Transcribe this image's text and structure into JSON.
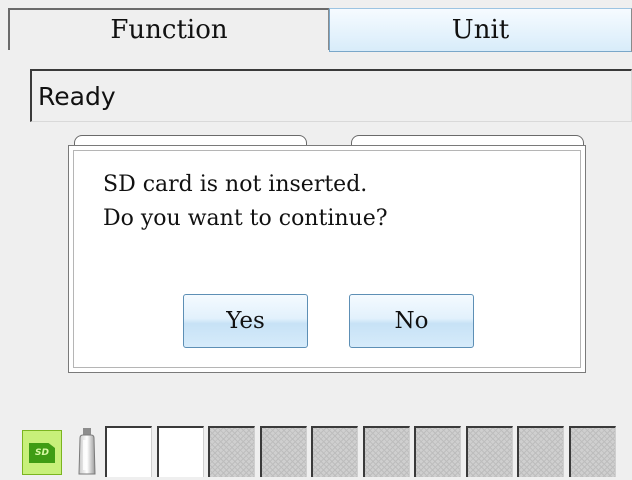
{
  "tabs": {
    "function_label": "Function",
    "unit_label": "Unit"
  },
  "status": {
    "text": "Ready"
  },
  "dialog": {
    "line1": "SD card is not inserted.",
    "line2": "Do you want to continue?",
    "yes_label": "Yes",
    "no_label": "No"
  },
  "indicators": {
    "sd_icon": "sd-card-icon",
    "sd_icon_text": "SD",
    "bottle_icon": "bottle-icon",
    "slots": [
      "empty",
      "empty",
      "disabled",
      "disabled",
      "disabled",
      "disabled",
      "disabled",
      "disabled",
      "disabled",
      "disabled"
    ]
  },
  "colors": {
    "background": "#efefef",
    "button_accent": "#c7e2f6",
    "sd_icon": "#c8f07a"
  }
}
